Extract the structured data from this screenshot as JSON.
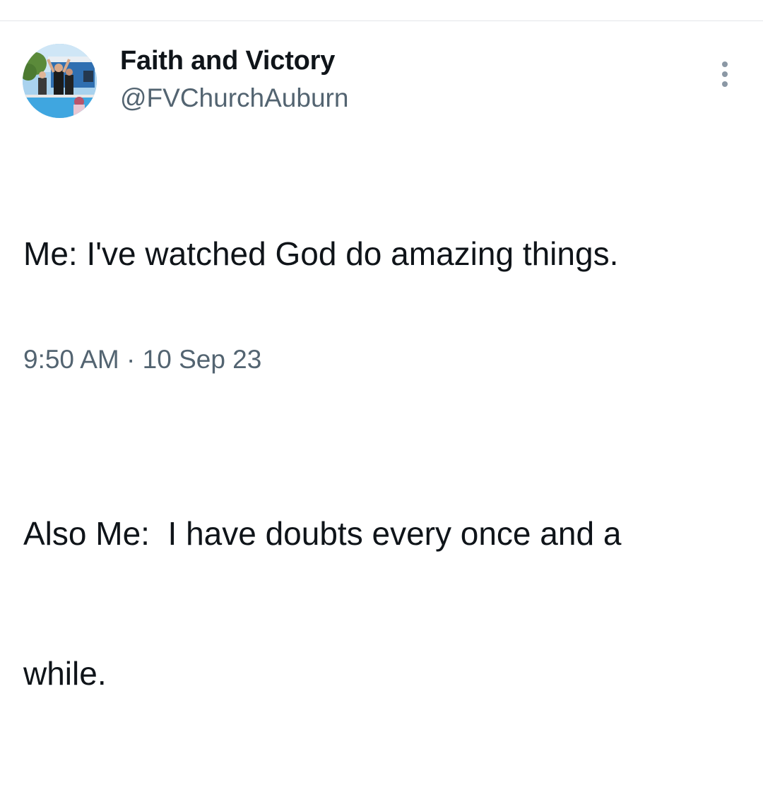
{
  "tweet": {
    "author": {
      "display_name": "Faith and Victory",
      "handle": "@FVChurchAuburn",
      "avatar_icon": "profile-photo"
    },
    "text_line_1": "Me: I've watched God do amazing things.",
    "text_line_2": "",
    "text_line_3": "Also Me:  I have doubts every once and a",
    "text_line_4": "while.",
    "timestamp": "9:50 AM · 10 Sep 23",
    "more_icon": "more-vertical-icon"
  },
  "colors": {
    "text_primary": "#0f1419",
    "text_secondary": "#536471",
    "divider": "#e3e6e9",
    "icon": "#8b98a5"
  }
}
